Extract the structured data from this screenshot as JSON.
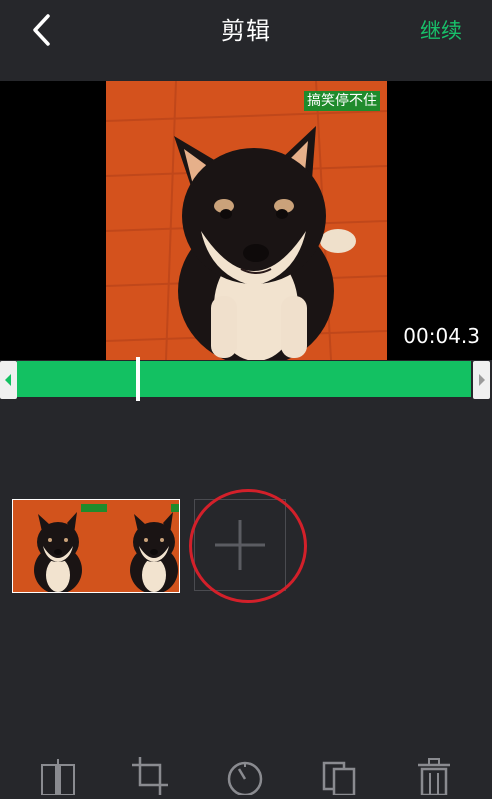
{
  "header": {
    "title": "剪辑",
    "continue_label": "继续"
  },
  "video": {
    "watermark": "搞笑停不住",
    "timecode": "00:04.3"
  },
  "clip_strip": {
    "clip_watermark": "搞笑停不住"
  },
  "toolbar": {
    "icons": [
      "split-icon",
      "crop-icon",
      "speed-icon",
      "duplicate-icon",
      "trash-icon"
    ]
  },
  "colors": {
    "accent": "#13c162",
    "background": "#26272b",
    "highlight_circle": "#d3202a"
  }
}
